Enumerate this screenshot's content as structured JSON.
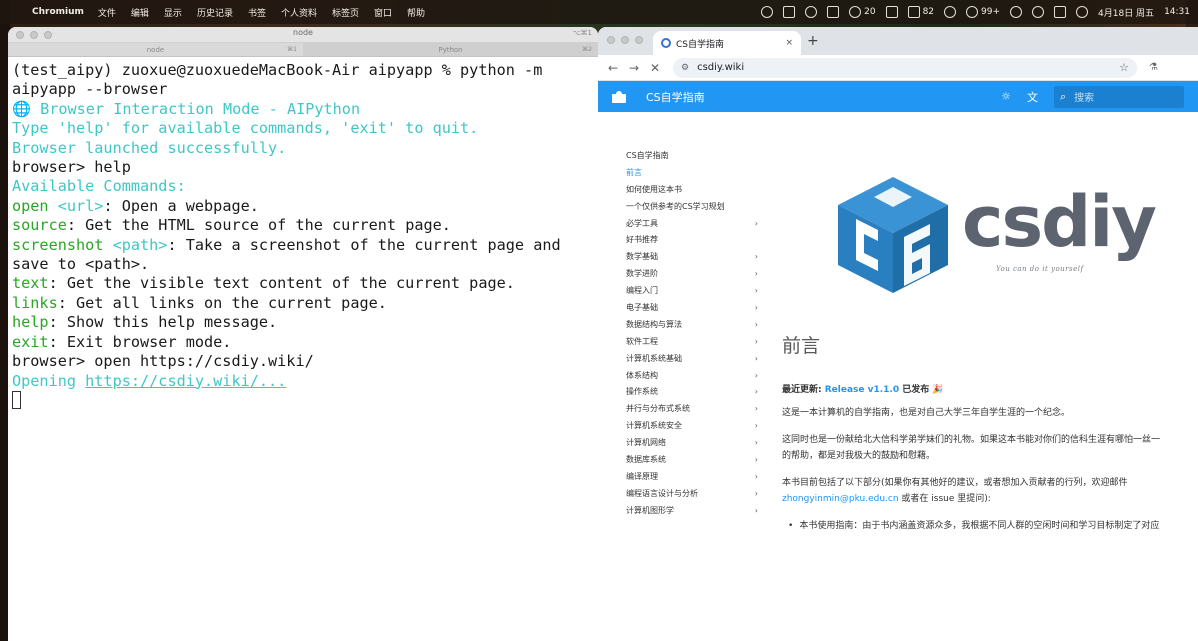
{
  "menubar": {
    "app_name": "Chromium",
    "items": [
      "文件",
      "编辑",
      "显示",
      "历史记录",
      "书签",
      "个人资料",
      "标签页",
      "窗口",
      "帮助"
    ],
    "status_20": "20",
    "status_82": "82",
    "status_99": "99+",
    "date": "4月18日 周五",
    "time": "14:31"
  },
  "terminal": {
    "window_title": "node",
    "window_shortcut": "⌥⌘1",
    "tabs": [
      {
        "label": "node",
        "shortcut": "⌘1"
      },
      {
        "label": "Python",
        "shortcut": "⌘2"
      }
    ],
    "lines": {
      "cmd": "(test_aipy) zuoxue@zuoxuedeMacBook-Air aipyapp % python -m aipyapp --browser",
      "mode_icon": "🌐",
      "mode": " Browser Interaction Mode - AIPython",
      "help_hint": "Type 'help' for available commands, 'exit' to quit.",
      "launched": "Browser launched successfully.",
      "prompt_help": "browser> help",
      "available": "Available Commands:",
      "open_cmd": "open",
      "open_arg": " <url>",
      "open_desc": ": Open a webpage.",
      "source_cmd": "source",
      "source_desc": ": Get the HTML source of the current page.",
      "screenshot_cmd": "screenshot",
      "screenshot_arg": " <path>",
      "screenshot_desc": ": Take a screenshot of the current page and save to <path>.",
      "text_cmd": "text",
      "text_desc": ": Get the visible text content of the current page.",
      "links_cmd": "links",
      "links_desc": ": Get all links on the current page.",
      "help_cmd": "help",
      "help_desc": ": Show this help message.",
      "exit_cmd": "exit",
      "exit_desc": ": Exit browser mode.",
      "prompt_open": "browser> open https://csdiy.wiki/",
      "opening_prefix": "Opening ",
      "opening_url": "https://csdiy.wiki/..."
    }
  },
  "browser": {
    "tab_title": "CS自学指南",
    "tab_close": "×",
    "new_tab": "+",
    "url": "csdiy.wiki",
    "header": {
      "site_title": "CS自学指南",
      "search_placeholder": "搜索"
    },
    "nav": [
      {
        "label": "CS自学指南",
        "chevron": false,
        "active": false
      },
      {
        "label": "前言",
        "chevron": false,
        "active": true
      },
      {
        "label": "如何使用这本书",
        "chevron": false,
        "active": false
      },
      {
        "label": "一个仅供参考的CS学习规划",
        "chevron": false,
        "active": false
      },
      {
        "label": "必学工具",
        "chevron": true,
        "active": false
      },
      {
        "label": "好书推荐",
        "chevron": false,
        "active": false
      },
      {
        "label": "数学基础",
        "chevron": true,
        "active": false
      },
      {
        "label": "数学进阶",
        "chevron": true,
        "active": false
      },
      {
        "label": "编程入门",
        "chevron": true,
        "active": false
      },
      {
        "label": "电子基础",
        "chevron": true,
        "active": false
      },
      {
        "label": "数据结构与算法",
        "chevron": true,
        "active": false
      },
      {
        "label": "软件工程",
        "chevron": true,
        "active": false
      },
      {
        "label": "计算机系统基础",
        "chevron": true,
        "active": false
      },
      {
        "label": "体系结构",
        "chevron": true,
        "active": false
      },
      {
        "label": "操作系统",
        "chevron": true,
        "active": false
      },
      {
        "label": "并行与分布式系统",
        "chevron": true,
        "active": false
      },
      {
        "label": "计算机系统安全",
        "chevron": true,
        "active": false
      },
      {
        "label": "计算机网络",
        "chevron": true,
        "active": false
      },
      {
        "label": "数据库系统",
        "chevron": true,
        "active": false
      },
      {
        "label": "编译原理",
        "chevron": true,
        "active": false
      },
      {
        "label": "编程语言设计与分析",
        "chevron": true,
        "active": false
      },
      {
        "label": "计算机图形学",
        "chevron": true,
        "active": false
      }
    ],
    "content": {
      "logo_text": "csdiy",
      "logo_tagline": "You can do it yourself",
      "h1": "前言",
      "latest_label": "最近更新: ",
      "latest_release": "Release v1.1.0",
      "latest_suffix": " 已发布 🎉",
      "para1": "这是一本计算机的自学指南，也是对自己大学三年自学生涯的一个纪念。",
      "para2a": "这同时也是一份献给北大信科学弟学妹们的礼物。如果这本书能对你们的信科生涯有哪怕一丝一",
      "para2b": "的帮助，都是对我极大的鼓励和慰藉。",
      "para3a": "本书目前包括了以下部分(如果你有其他好的建议，或者想加入贡献者的行列，欢迎邮件",
      "para3_email": "zhongyinmin@pku.edu.cn",
      "para3_suffix": " 或者在 issue 里提问):",
      "bullet1": "本书使用指南：由于书内涵盖资源众多，我根据不同人群的空闲时间和学习目标制定了对应"
    }
  },
  "colors": {
    "accent": "#2196f3",
    "terminal_cyan": "#3fc7c7",
    "terminal_green": "#2aa626",
    "logo_blue": "#2a7fc1",
    "logo_gray": "#5d6470"
  }
}
